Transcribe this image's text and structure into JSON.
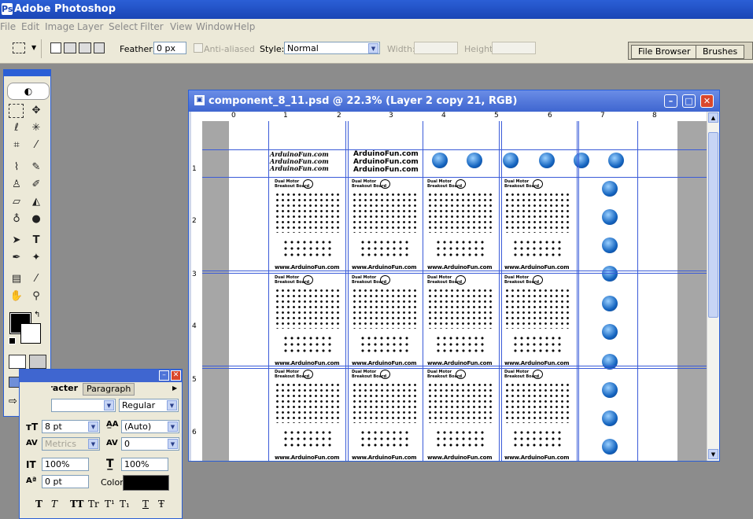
{
  "app": {
    "title": "Adobe Photoshop"
  },
  "menu": [
    "File",
    "Edit",
    "Image",
    "Layer",
    "Select",
    "Filter",
    "View",
    "Window",
    "Help"
  ],
  "options": {
    "feather_label": "Feather:",
    "feather_value": "0 px",
    "antialiased_label": "Anti-aliased",
    "style_label": "Style:",
    "style_value": "Normal",
    "width_label": "Width:",
    "height_label": "Height:",
    "well_tabs": [
      "File Browser",
      "Brushes"
    ]
  },
  "document": {
    "title": "component_8_11.psd @ 22.3% (Layer 2 copy 21, RGB)",
    "ruler_top": [
      "0",
      "1",
      "2",
      "3",
      "4",
      "5",
      "6",
      "7",
      "8"
    ],
    "ruler_left": [
      "1",
      "2",
      "3",
      "4",
      "5",
      "6"
    ],
    "banner_lines_script": [
      "ArduinoFun.com",
      "ArduinoFun.com",
      "ArduinoFun.com"
    ],
    "banner_lines_plain": [
      "ArduinoFun.com",
      "ArduinoFun.com",
      "ArduinoFun.com"
    ],
    "board_title": "Dual Motor\nBreakout Board",
    "board_url": "www.ArduinoFun.com",
    "logo_text": "arduinofun"
  },
  "character_panel": {
    "tabs": [
      "Character",
      "Paragraph"
    ],
    "font_style": "Regular",
    "font_size": "8 pt",
    "leading": "(Auto)",
    "kerning": "Metrics",
    "tracking": "0",
    "vertical_scale": "100%",
    "horizontal_scale": "100%",
    "baseline_shift": "0 pt",
    "color_label": "Color:",
    "style_buttons": [
      "T",
      "T",
      "TT",
      "Tr",
      "T¹",
      "T₁",
      "T",
      "Ŧ"
    ]
  }
}
